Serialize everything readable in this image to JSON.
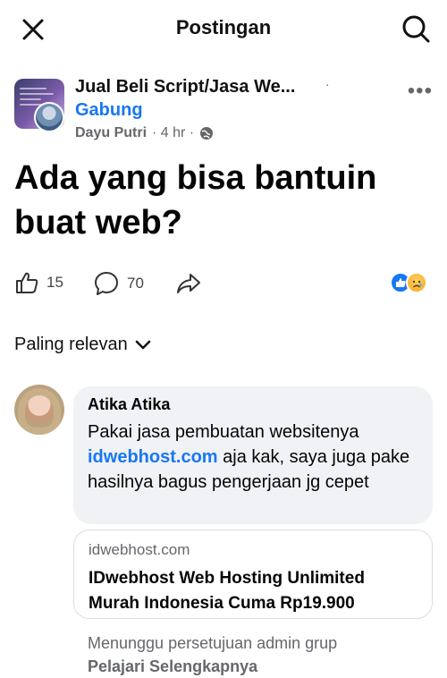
{
  "header": {
    "title": "Postingan",
    "close_icon": "close-icon",
    "search_icon": "search-icon"
  },
  "group": {
    "name": "Jual Beli Script/Jasa We...",
    "separator": "·",
    "join_label": "Gabung",
    "author": "Dayu Putri",
    "time": "· 4 hr ·",
    "privacy_icon": "globe-icon",
    "more_label": "•••"
  },
  "post": {
    "title": "Ada yang bisa bantuin buat web?"
  },
  "actions": {
    "like_count": "15",
    "comment_count": "70",
    "like_icon": "thumbs-up-icon",
    "comment_icon": "comment-icon",
    "share_icon": "share-icon",
    "reactions": [
      "like",
      "sad"
    ]
  },
  "sort": {
    "label": "Paling relevan"
  },
  "comment": {
    "author": "Atika Atika",
    "text_before": "Pakai jasa pembuatan websitenya ",
    "link": "idwebhost.com",
    "text_after": " aja kak, saya juga pake hasilnya bagus pengerjaan jg cepet",
    "preview": {
      "domain": "idwebhost.com",
      "title": "IDwebhost Web Hosting Unlimited Murah Indonesia Cuma Rp19.900"
    },
    "pending_text": "Menunggu persetujuan admin grup",
    "learn_more": "Pelajari Selengkapnya"
  },
  "colors": {
    "accent": "#1877f2",
    "secondary_text": "#65676b",
    "bubble_bg": "#f0f2f5"
  }
}
